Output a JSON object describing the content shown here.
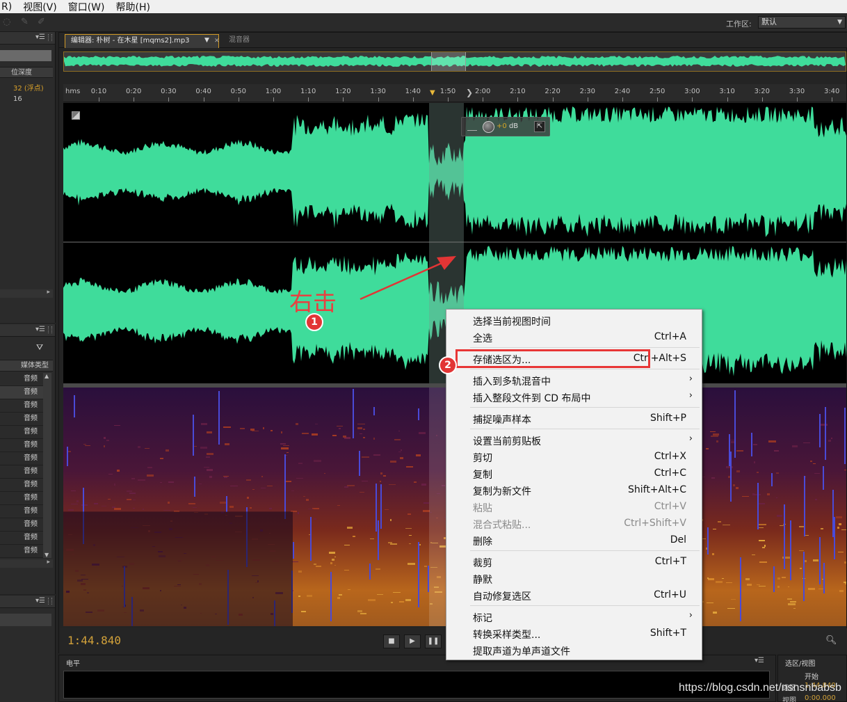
{
  "menubar": {
    "items": [
      "R)",
      "视图(V)",
      "窗口(W)",
      "帮助(H)"
    ]
  },
  "toolbar": {
    "workspace_label": "工作区:",
    "workspace_value": "默认"
  },
  "left_panel_top": {
    "header": "位深度",
    "values": [
      "32 (浮点)",
      "16"
    ]
  },
  "left_panel_files": {
    "header": "媒体类型",
    "rows": [
      "音频",
      "音频",
      "音频",
      "音频",
      "音频",
      "音频",
      "音频",
      "音频",
      "音频",
      "音频",
      "音频",
      "音频",
      "音频",
      "音频"
    ]
  },
  "editor": {
    "tab_label": "编辑器: 朴树 - 在木星 [mqms2].mp3",
    "mixer_tab_label": "混音器",
    "hms_label": "hms",
    "ruler_ticks": [
      "0:10",
      "0:20",
      "0:30",
      "0:40",
      "0:50",
      "1:00",
      "1:10",
      "1:20",
      "1:30",
      "1:40",
      "1:50",
      "2:00",
      "2:10",
      "2:20",
      "2:30",
      "2:40",
      "2:50",
      "3:00",
      "3:10",
      "3:20",
      "3:30",
      "3:40"
    ],
    "hud_gain": "+0",
    "hud_unit": "dB",
    "timecode": "1:44.840"
  },
  "colors": {
    "waveform": "#3fdc9b",
    "accent": "#d29a26",
    "timecode": "#d3a23a",
    "annotation": "#e23535"
  },
  "levels_panel": {
    "title": "电平"
  },
  "selection_panel": {
    "title": "选区/视图",
    "column_start": "开始",
    "row_selection": "选区",
    "row_view": "视图",
    "sel_start": "1:44.840",
    "view_start": "0:00.000"
  },
  "context_menu": {
    "items": [
      {
        "label": "选择当前视图时间",
        "shortcut": "",
        "submenu": false,
        "disabled": false
      },
      {
        "label": "全选",
        "shortcut": "Ctrl+A",
        "submenu": false,
        "disabled": false
      },
      {
        "label": "存储选区为...",
        "shortcut": "Ctrl+Alt+S",
        "submenu": false,
        "disabled": false
      },
      {
        "label": "插入到多轨混音中",
        "shortcut": "",
        "submenu": true,
        "disabled": false
      },
      {
        "label": "插入整段文件到 CD 布局中",
        "shortcut": "",
        "submenu": true,
        "disabled": false
      },
      {
        "label": "捕捉噪声样本",
        "shortcut": "Shift+P",
        "submenu": false,
        "disabled": false
      },
      {
        "label": "设置当前剪贴板",
        "shortcut": "",
        "submenu": true,
        "disabled": false
      },
      {
        "label": "剪切",
        "shortcut": "Ctrl+X",
        "submenu": false,
        "disabled": false
      },
      {
        "label": "复制",
        "shortcut": "Ctrl+C",
        "submenu": false,
        "disabled": false
      },
      {
        "label": "复制为新文件",
        "shortcut": "Shift+Alt+C",
        "submenu": false,
        "disabled": false
      },
      {
        "label": "粘贴",
        "shortcut": "Ctrl+V",
        "submenu": false,
        "disabled": true
      },
      {
        "label": "混合式粘贴...",
        "shortcut": "Ctrl+Shift+V",
        "submenu": false,
        "disabled": true
      },
      {
        "label": "删除",
        "shortcut": "Del",
        "submenu": false,
        "disabled": false
      },
      {
        "label": "裁剪",
        "shortcut": "Ctrl+T",
        "submenu": false,
        "disabled": false
      },
      {
        "label": "静默",
        "shortcut": "",
        "submenu": false,
        "disabled": false
      },
      {
        "label": "自动修复选区",
        "shortcut": "Ctrl+U",
        "submenu": false,
        "disabled": false
      },
      {
        "label": "标记",
        "shortcut": "",
        "submenu": true,
        "disabled": false
      },
      {
        "label": "转换采样类型...",
        "shortcut": "Shift+T",
        "submenu": false,
        "disabled": false
      },
      {
        "label": "提取声道为单声道文件",
        "shortcut": "",
        "submenu": false,
        "disabled": false
      }
    ]
  },
  "annotations": {
    "text": "右击",
    "badge1": "1",
    "badge2": "2"
  },
  "watermark": "https://blog.csdn.net/nsnsnbabsb"
}
